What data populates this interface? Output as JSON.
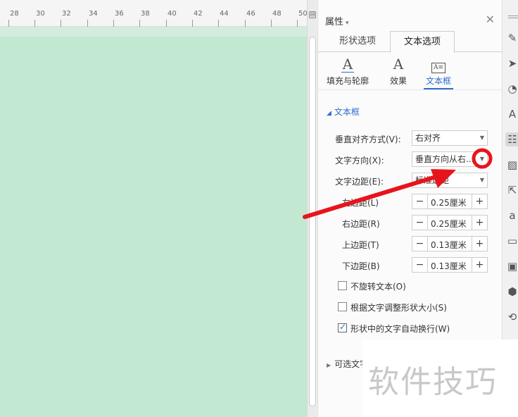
{
  "ruler": {
    "ticks": [
      "28",
      "30",
      "32",
      "34",
      "36",
      "38",
      "40",
      "42",
      "44",
      "46",
      "48",
      "50"
    ]
  },
  "panel": {
    "title": "属性",
    "tabs": [
      {
        "label": "形状选项",
        "active": false
      },
      {
        "label": "文本选项",
        "active": true
      }
    ],
    "subtabs": [
      {
        "label": "填充与轮廓",
        "icon": "text-fill-icon",
        "glyph": "A",
        "active": false
      },
      {
        "label": "效果",
        "icon": "text-effect-icon",
        "glyph": "A",
        "active": false
      },
      {
        "label": "文本框",
        "icon": "textbox-icon",
        "glyph": "A≡",
        "active": true
      }
    ],
    "section_title": "文本框",
    "fields": {
      "valign": {
        "label": "垂直对齐方式(V):",
        "value": "右对齐"
      },
      "direction": {
        "label": "文字方向(X):",
        "value": "垂直方向从右..."
      },
      "margin": {
        "label": "文字边距(E):",
        "value": "标准边距"
      },
      "left": {
        "label": "左边距(L)",
        "value": "0.25厘米"
      },
      "right": {
        "label": "右边距(R)",
        "value": "0.25厘米"
      },
      "top": {
        "label": "上边距(T)",
        "value": "0.13厘米"
      },
      "bottom": {
        "label": "下边距(B)",
        "value": "0.13厘米"
      }
    },
    "checks": [
      {
        "label": "不旋转文本(O)",
        "checked": false
      },
      {
        "label": "根据文字调整形状大小(S)",
        "checked": false
      },
      {
        "label": "形状中的文字自动换行(W)",
        "checked": true
      }
    ],
    "collapsed_section": "可选文字"
  },
  "strip_icons": [
    "eraser-icon",
    "cursor-icon",
    "shapes-icon",
    "text-style-icon",
    "properties-icon",
    "image-edit-icon",
    "share-icon",
    "text-transform-icon",
    "archive-icon",
    "picture-icon",
    "shield-icon",
    "history-icon"
  ],
  "watermark": "软件技巧",
  "colors": {
    "canvas": "#c3e8d1",
    "accent": "#2d6ccf",
    "annotation": "#e8141c"
  }
}
